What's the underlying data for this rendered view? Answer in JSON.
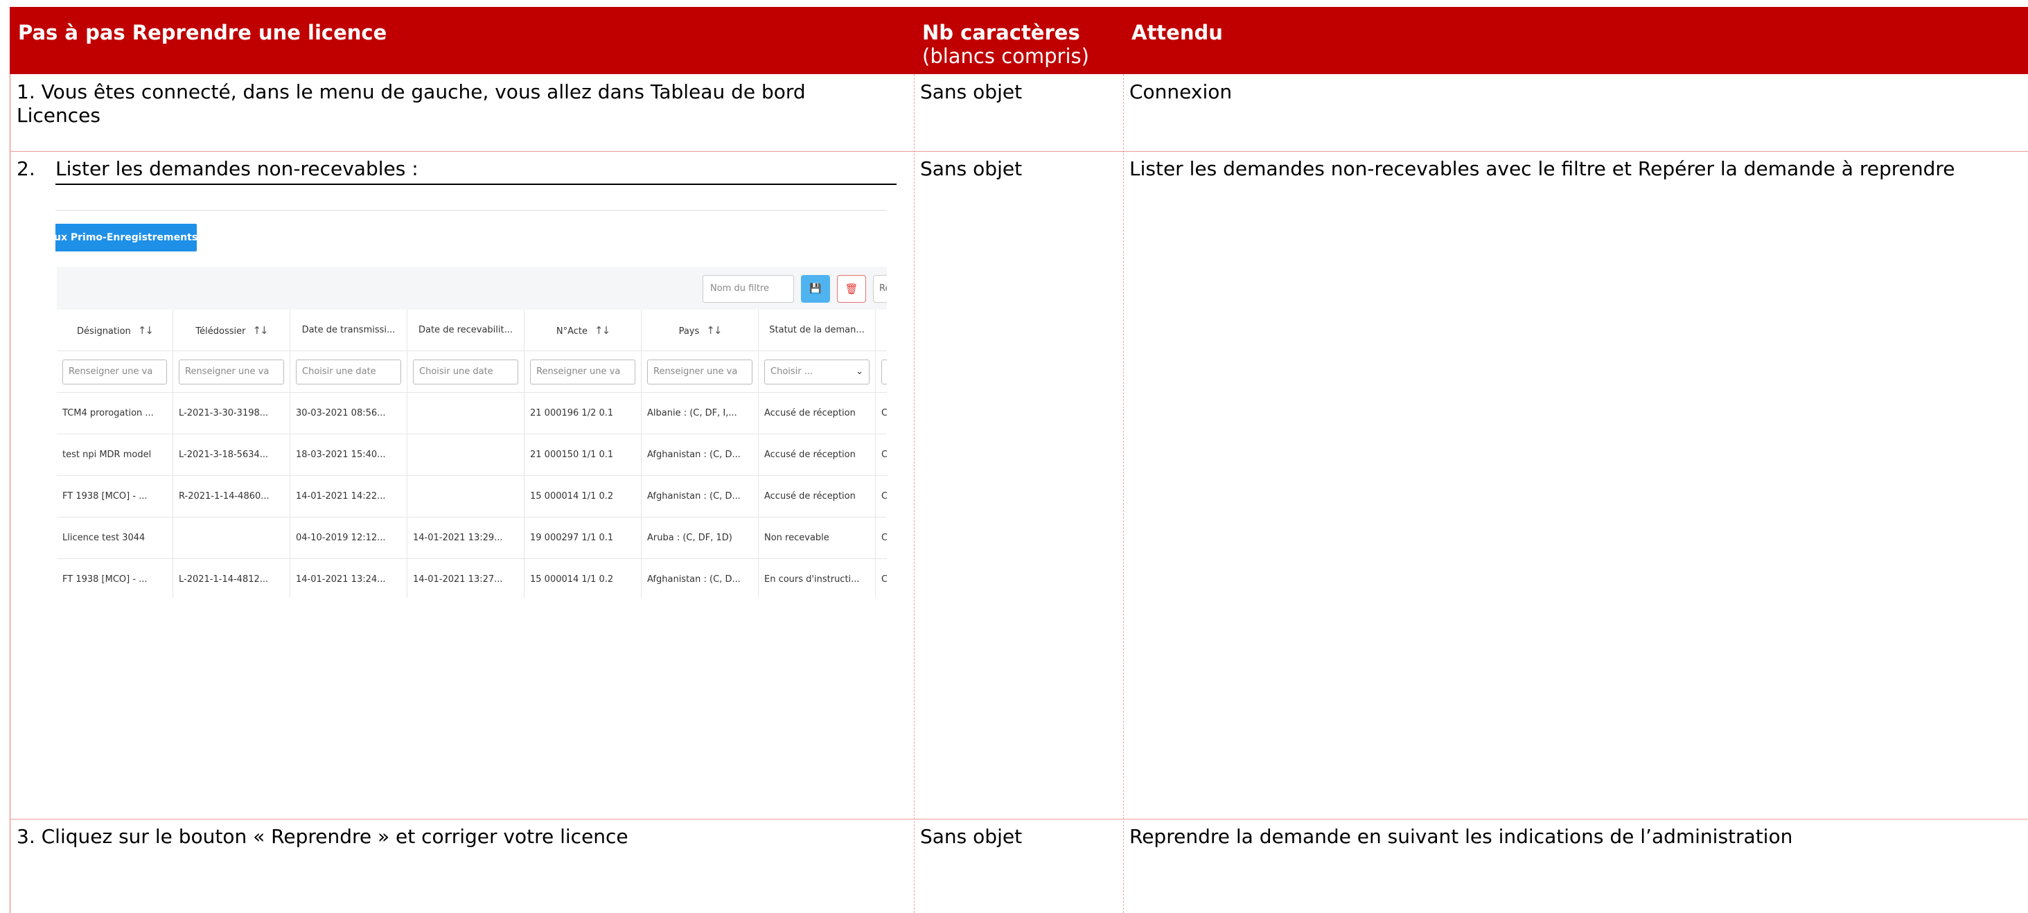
{
  "header": {
    "col1": "Pas à pas Reprendre une licence",
    "col2_title": "Nb caractères",
    "col2_sub": "(blancs compris)",
    "col3": "Attendu"
  },
  "rows": [
    {
      "step_line1": "1.   Vous êtes connecté, dans le menu de gauche, vous allez dans Tableau de bord",
      "step_line2": "Licences",
      "nb": "Sans objet",
      "expected": "Connexion"
    },
    {
      "step_num": "2.",
      "step_text": "Lister  les  demandes  non-recevables :",
      "nb": "Sans objet",
      "expected": "Lister les demandes non-recevables avec le filtre et Repérer la demande à reprendre"
    },
    {
      "step_line1": "3. Cliquez sur le bouton « Reprendre » et corriger votre licence",
      "nb": "Sans objet",
      "expected": "Reprendre la demande en suivant les indications de l’administration"
    }
  ],
  "screenshot": {
    "primo_button": "ux Primo-Enregistrements",
    "filter_name_placeholder": "Nom du filtre",
    "save_icon": "save-icon",
    "delete_icon": "trash-icon",
    "re_button": "Re",
    "columns": [
      "Désignation",
      "Télédossier",
      "Date de transmissi...",
      "Date de recevabilit...",
      "N°Acte",
      "Pays",
      "Statut de la deman..."
    ],
    "filters": [
      "Renseigner une va",
      "Renseigner une va",
      "Choisir une date",
      "Choisir une date",
      "Renseigner une va",
      "Renseigner une va",
      "Choisir ..."
    ],
    "rows": [
      [
        "TCM4 prorogation ...",
        "L-2021-3-30-3198...",
        "30-03-2021 08:56...",
        "",
        "21 000196 1/2 0.1",
        "Albanie : (C, DF, I,...",
        "Accusé de réception"
      ],
      [
        "test npi MDR model",
        "L-2021-3-18-5634...",
        "18-03-2021 15:40...",
        "",
        "21 000150 1/1 0.1",
        "Afghanistan : (C, D...",
        "Accusé de réception"
      ],
      [
        "FT 1938 [MCO] - ...",
        "R-2021-1-14-4860...",
        "14-01-2021 14:22...",
        "",
        "15 000014 1/1 0.2",
        "Afghanistan : (C, D...",
        "Accusé de réception"
      ],
      [
        "Llicence test 3044",
        "",
        "04-10-2019 12:12...",
        "14-01-2021 13:29...",
        "19 000297 1/1 0.1",
        "Aruba : (C, DF, 1D)",
        "Non recevable"
      ],
      [
        "FT 1938 [MCO] - ...",
        "L-2021-1-14-4812...",
        "14-01-2021 13:24...",
        "14-01-2021 13:27...",
        "15 000014 1/1 0.2",
        "Afghanistan : (C, D...",
        "En cours d'instructi..."
      ]
    ],
    "extra_col_char": "C"
  }
}
